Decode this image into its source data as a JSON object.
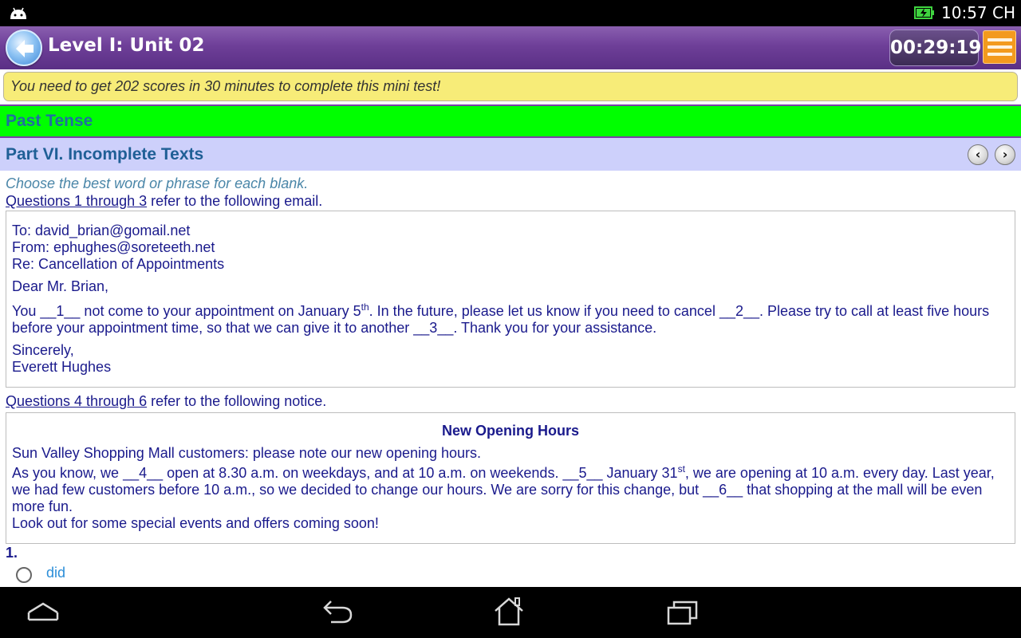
{
  "status_bar": {
    "time": "10:57 CH"
  },
  "header": {
    "title": "Level I: Unit 02",
    "timer": "00:29:19"
  },
  "notice": "You need to get 202 scores in 30 minutes to complete this mini test!",
  "topic": "Past Tense",
  "part_title": "Part VI. Incomplete Texts",
  "part_nav": {
    "prev": "‹",
    "next": "›"
  },
  "content": {
    "instruction": "Choose the best word or phrase for each blank.",
    "email_ref": {
      "link": "Questions 1 through 3",
      "rest": " refer to the following email."
    },
    "email": {
      "to": "To: david_brian@gomail.net",
      "from": "From: ephughes@soreteeth.net",
      "re": "Re: Cancellation of Appointments",
      "greeting": "Dear Mr. Brian,",
      "body_a": "You __1__ not come to your appointment on January 5",
      "body_sup": "th",
      "body_b": ". In the future, please let us know if you need to cancel __2__. Please try to call at least five hours before your appointment time, so that we can give it to another __3__. Thank you for your assistance.",
      "closing": "Sincerely,",
      "signature": "Everett Hughes"
    },
    "notice_ref": {
      "link": "Questions 4 through 6",
      "rest": " refer to the following notice."
    },
    "notice_text": {
      "title": "New Opening Hours",
      "line1": "Sun Valley Shopping Mall customers: please note our new opening hours.",
      "body_a": "As you know, we __4__ open at 8.30 a.m. on weekdays, and at 10 a.m. on weekends. __5__ January 31",
      "body_sup": "st",
      "body_b": ", we are opening at 10 a.m. every day. Last year, we had few customers before 10 a.m., so we decided to change our hours. We are sorry for this change, but __6__ that shopping at the mall will be even more fun.",
      "line_last": "Look out for some special events and offers coming soon!"
    },
    "question": {
      "number": "1.",
      "options": [
        "did"
      ]
    }
  },
  "colors": {
    "header_purple": "#6e3f98",
    "notice_yellow": "#f7ec78",
    "topic_green": "#00ff00",
    "part_lavender": "#cdd0fb",
    "text_navy": "#1a1a8c",
    "option_blue": "#2c8ed8",
    "menu_orange": "#f39a1e"
  },
  "icons": {
    "status_left": "android-icon",
    "status_battery": "battery-charging-icon",
    "back": "back-arrow-icon",
    "menu": "hamburger-menu-icon",
    "nav_up": "chevron-up-icon",
    "nav_back": "back-icon",
    "nav_home": "home-icon",
    "nav_recents": "recents-icon"
  }
}
